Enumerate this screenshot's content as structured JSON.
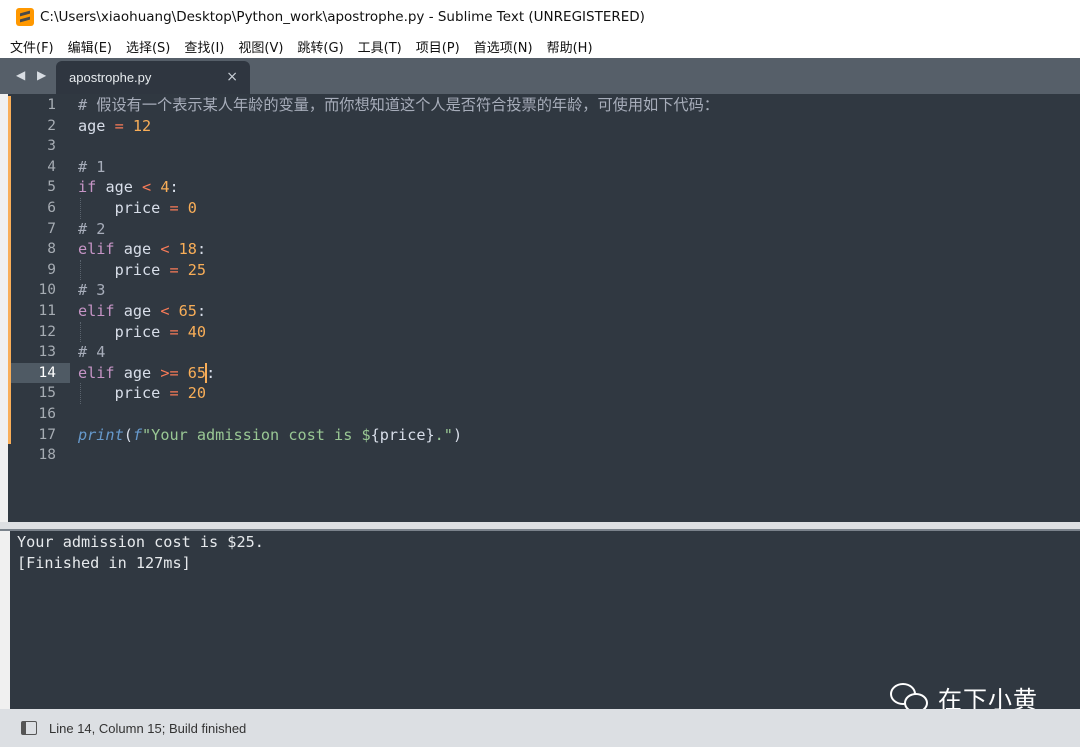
{
  "window": {
    "title": "C:\\Users\\xiaohuang\\Desktop\\Python_work\\apostrophe.py - Sublime Text (UNREGISTERED)"
  },
  "menu": [
    "文件(F)",
    "编辑(E)",
    "选择(S)",
    "查找(I)",
    "视图(V)",
    "跳转(G)",
    "工具(T)",
    "项目(P)",
    "首选项(N)",
    "帮助(H)"
  ],
  "tab": {
    "nav_label": "◀ ▶",
    "file_name": "apostrophe.py",
    "close_glyph": "×"
  },
  "editor": {
    "active_line": 14,
    "cursor_column": 15,
    "line_numbers": [
      "1",
      "2",
      "3",
      "4",
      "5",
      "6",
      "7",
      "8",
      "9",
      "10",
      "11",
      "12",
      "13",
      "14",
      "15",
      "16",
      "17",
      "18"
    ],
    "lines": [
      "# 假设有一个表示某人年龄的变量，而你想知道这个人是否符合投票的年龄，可使用如下代码：",
      "age = 12",
      "",
      "# 1",
      "if age < 4:",
      "    price = 0",
      "# 2",
      "elif age < 18:",
      "    price = 25",
      "# 3",
      "elif age < 65:",
      "    price = 40",
      "# 4",
      "elif age >= 65:",
      "    price = 20",
      "",
      "print(f\"Your admission cost is ${price}.\")",
      ""
    ]
  },
  "output": {
    "lines": [
      "Your admission cost is $25.",
      "[Finished in 127ms]"
    ]
  },
  "watermark": {
    "icon": "wechat-icon",
    "text": "在下小黄"
  },
  "status": {
    "text": "Line 14, Column 15; Build finished"
  },
  "colors": {
    "editor_bg": "#303841",
    "keyword": "#c594c5",
    "operator": "#f97b58",
    "number": "#f9ae58",
    "string": "#99c794",
    "function": "#6699cc",
    "comment": "#a7adba",
    "tab_bar": "#565f69",
    "status_bar": "#dcdfe3"
  }
}
